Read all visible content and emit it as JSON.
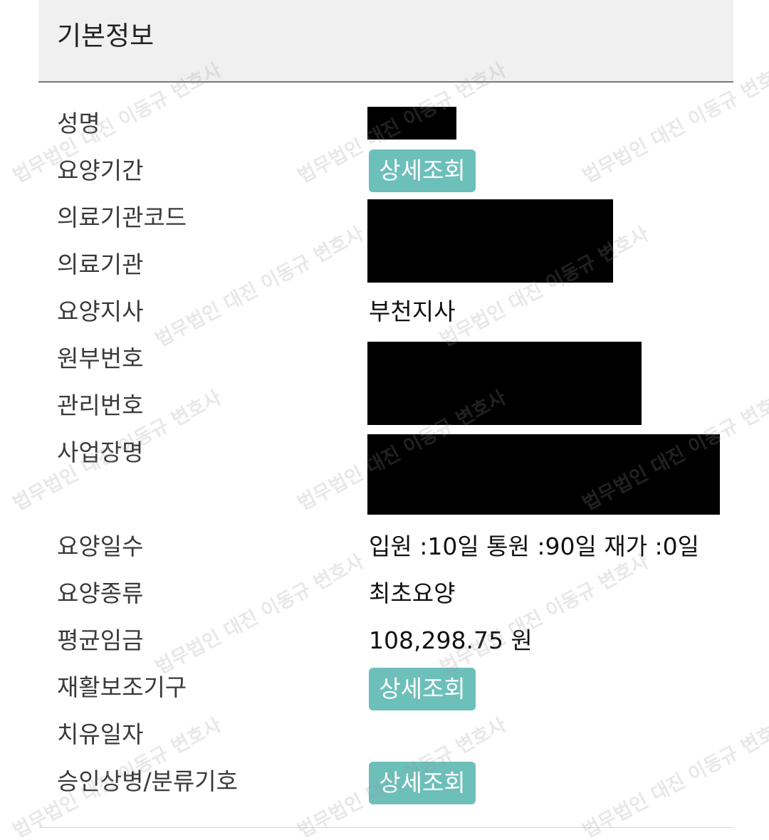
{
  "header": {
    "title": "기본정보"
  },
  "rows": {
    "name": {
      "label": "성명"
    },
    "care_period": {
      "label": "요양기간",
      "button": "상세조회"
    },
    "institution_code": {
      "label": "의료기관코드"
    },
    "institution": {
      "label": "의료기관"
    },
    "branch": {
      "label": "요양지사",
      "value": "부천지사"
    },
    "original_number": {
      "label": "원부번호"
    },
    "management_number": {
      "label": "관리번호"
    },
    "workplace": {
      "label": "사업장명"
    },
    "care_days": {
      "label": "요양일수",
      "value": "입원 :10일 통원 :90일 재가 :0일",
      "inpatient_days": 10,
      "outpatient_days": 90,
      "home_days": 0
    },
    "care_type": {
      "label": "요양종류",
      "value": "최초요양"
    },
    "average_wage": {
      "label": "평균임금",
      "value": "108,298.75 원"
    },
    "rehab_device": {
      "label": "재활보조기구",
      "button": "상세조회"
    },
    "cure_date": {
      "label": "치유일자"
    },
    "approved_injury": {
      "label": "승인상병/분류기호",
      "button": "상세조회"
    }
  },
  "watermark": {
    "text": "법무법인 대진 이동규 변호사"
  },
  "colors": {
    "button_bg": "#6dbfba",
    "header_bg": "#f0f0f0",
    "redaction": "#000000"
  }
}
